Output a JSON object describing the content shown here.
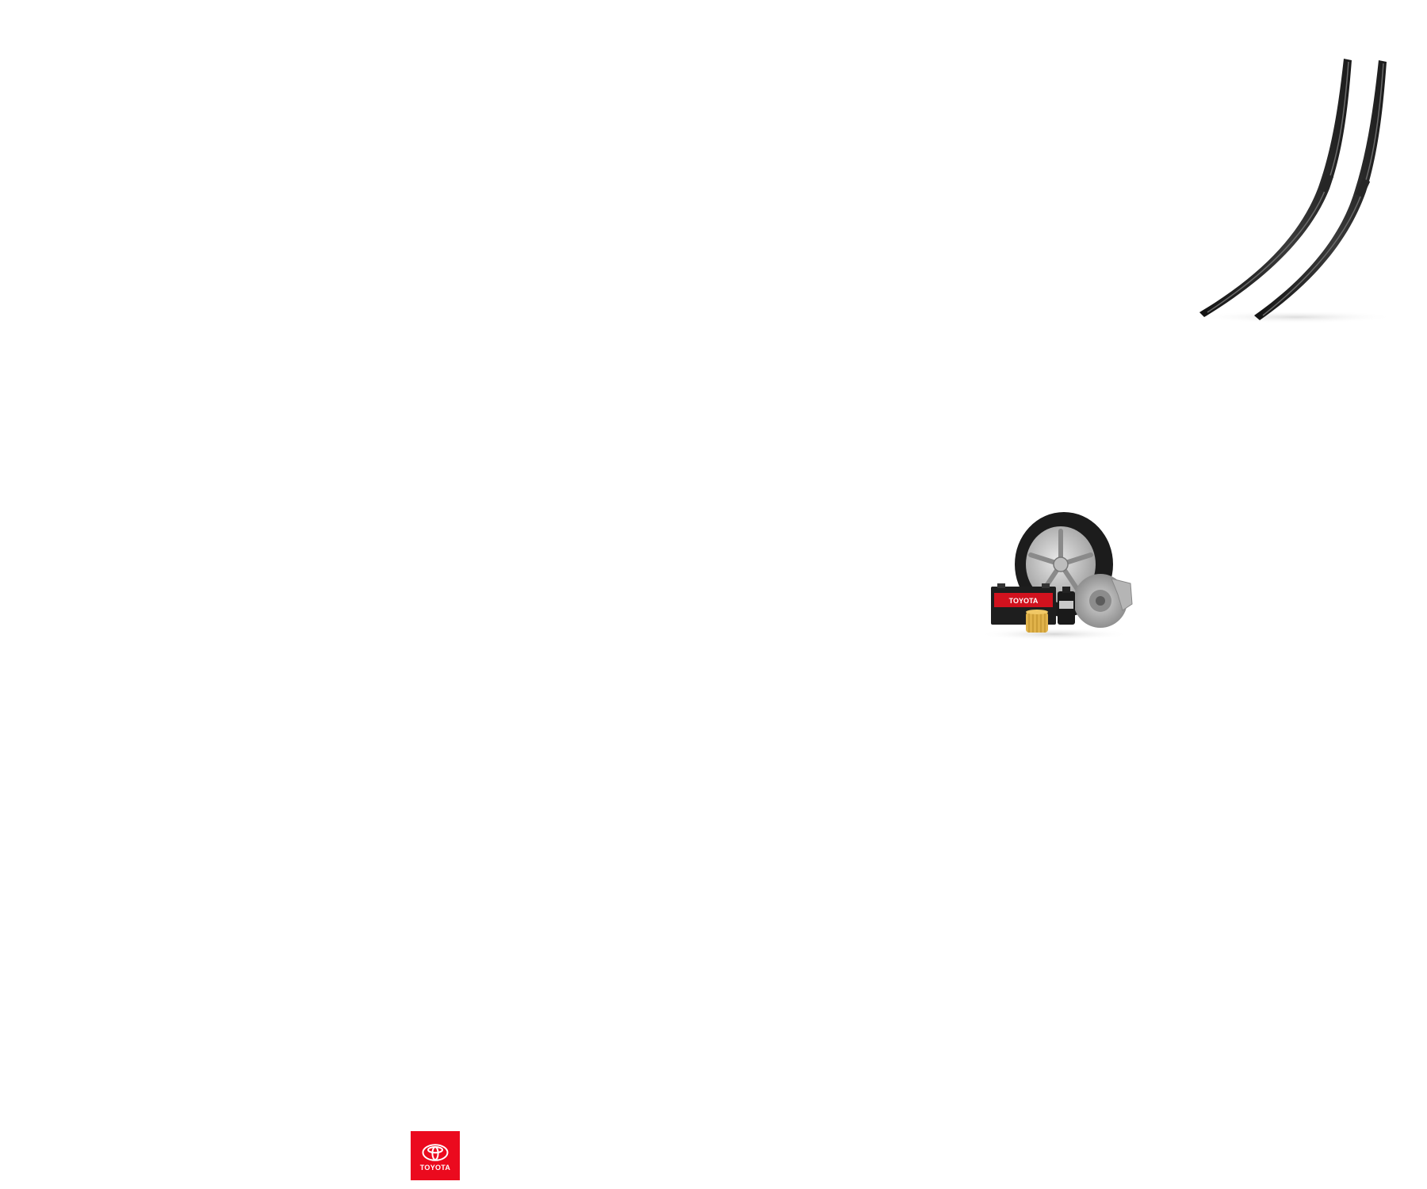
{
  "images": {
    "wiper_blades": "wiper-blades-image",
    "parts_group": "toyota-parts-image"
  },
  "parts_group": {
    "battery_label": "TOYOTA"
  },
  "logo": {
    "label": "TOYOTA",
    "brand_color": "#eb0a1e",
    "text_color": "#ffffff"
  }
}
